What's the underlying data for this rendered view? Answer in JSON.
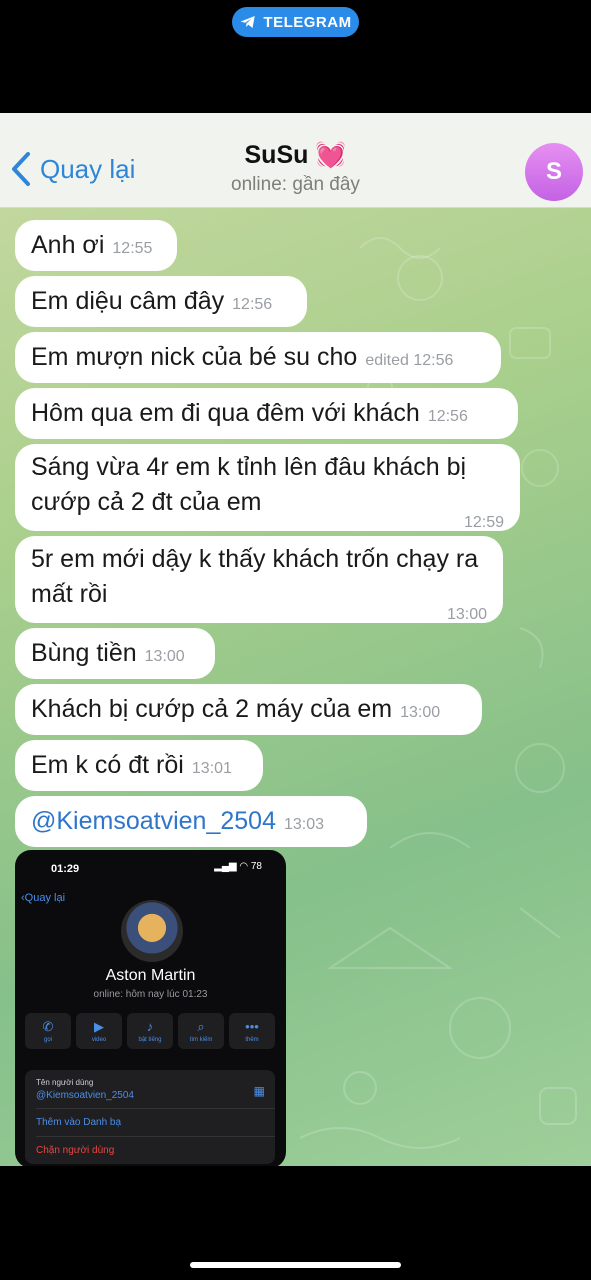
{
  "badge": {
    "label": "TELEGRAM"
  },
  "header": {
    "back_label": "Quay lại",
    "title": "SuSu",
    "title_emoji": "💓",
    "status": "online: gần đây",
    "avatar_letter": "S",
    "avatar_color": "#d67ae9"
  },
  "messages": [
    {
      "text": "Anh ơi",
      "time": "12:55"
    },
    {
      "text": "Em diệu câm đây",
      "time": "12:56"
    },
    {
      "text": "Em mượn nick của bé su cho",
      "time": "edited 12:56"
    },
    {
      "text": "Hôm qua em đi qua đêm với khách",
      "time": "12:56"
    },
    {
      "text": "Sáng vừa 4r em k tỉnh lên đâu khách bị cướp cả 2 đt của em",
      "time": "12:59"
    },
    {
      "text": "5r em mới dậy k thấy khách trốn chạy ra mất rồi",
      "time": "13:00"
    },
    {
      "text": "Bùng tiền",
      "time": "13:00"
    },
    {
      "text": "Khách bị cướp cả 2 máy của em",
      "time": "13:00"
    },
    {
      "text": "Em k có đt rồi",
      "time": "13:01"
    },
    {
      "text": "@Kiemsoatvien_2504",
      "time": "13:03"
    }
  ],
  "screenshot": {
    "clock": "01:29",
    "battery": "78",
    "back_label": "Quay lại",
    "name": "Aston Martin",
    "status": "online: hôm nay lúc 01:23",
    "actions": [
      {
        "icon": "phone-icon",
        "label": "gọi"
      },
      {
        "icon": "video-icon",
        "label": "video"
      },
      {
        "icon": "bell-icon",
        "label": "bật tiếng"
      },
      {
        "icon": "search-icon",
        "label": "tìm kiếm"
      },
      {
        "icon": "more-icon",
        "label": "thêm"
      }
    ],
    "username_label": "Tên người dùng",
    "username": "@Kiemsoatvien_2504",
    "add_contact": "Thêm vào Danh bạ",
    "block_user": "Chặn người dùng"
  },
  "colors": {
    "accent": "#2f86d8",
    "danger": "#e8463f",
    "bubble": "#ffffff"
  }
}
